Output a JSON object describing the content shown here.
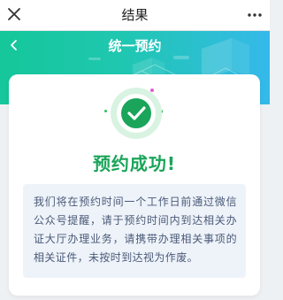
{
  "window": {
    "title": "结果"
  },
  "banner": {
    "title": "统一预约"
  },
  "result": {
    "title": "预约成功!",
    "message": "我们将在预约时间一个工作日前通过微信公众号提醒，请于预约时间内到达相关办证大厅办理业务，请携带办理相关事项的相关证件，未按时到达视为作废。"
  },
  "colors": {
    "success": "#1aa55a",
    "banner_start": "#15c79a",
    "banner_end": "#35b9ea"
  },
  "icons": [
    "close-icon",
    "more-icon",
    "back-icon",
    "checkmark-icon"
  ]
}
